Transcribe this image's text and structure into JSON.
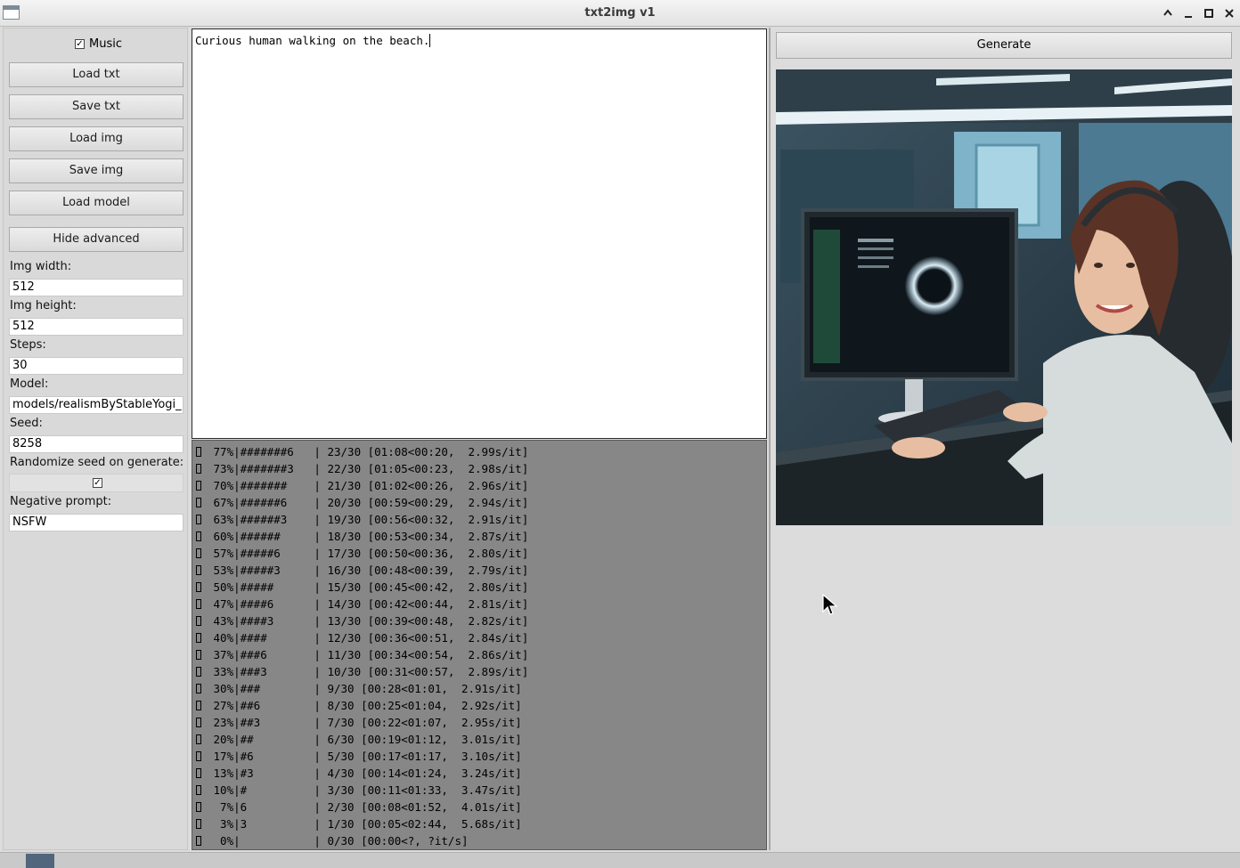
{
  "window": {
    "title": "txt2img v1"
  },
  "sidebar": {
    "music_label": "Music",
    "music_checked": true,
    "buttons": {
      "load_txt": "Load txt",
      "save_txt": "Save txt",
      "load_img": "Load img",
      "save_img": "Save img",
      "load_model": "Load model",
      "hide_advanced": "Hide advanced"
    },
    "fields": {
      "img_width_label": "Img width:",
      "img_width_value": "512",
      "img_height_label": "Img height:",
      "img_height_value": "512",
      "steps_label": "Steps:",
      "steps_value": "30",
      "model_label": "Model:",
      "model_value": "models/realismByStableYogi_",
      "seed_label": "Seed:",
      "seed_value": "8258",
      "randomize_label": "Randomize seed on generate:",
      "randomize_checked": true,
      "negative_label": "Negative prompt:",
      "negative_value": "NSFW"
    }
  },
  "prompt": {
    "text": "Curious human walking on the beach."
  },
  "console": {
    "lines": [
      " 77%|#######6   | 23/30 [01:08<00:20,  2.99s/it]",
      " 73%|#######3   | 22/30 [01:05<00:23,  2.98s/it]",
      " 70%|#######    | 21/30 [01:02<00:26,  2.96s/it]",
      " 67%|######6    | 20/30 [00:59<00:29,  2.94s/it]",
      " 63%|######3    | 19/30 [00:56<00:32,  2.91s/it]",
      " 60%|######     | 18/30 [00:53<00:34,  2.87s/it]",
      " 57%|#####6     | 17/30 [00:50<00:36,  2.80s/it]",
      " 53%|#####3     | 16/30 [00:48<00:39,  2.79s/it]",
      " 50%|#####      | 15/30 [00:45<00:42,  2.80s/it]",
      " 47%|####6      | 14/30 [00:42<00:44,  2.81s/it]",
      " 43%|####3      | 13/30 [00:39<00:48,  2.82s/it]",
      " 40%|####       | 12/30 [00:36<00:51,  2.84s/it]",
      " 37%|###6       | 11/30 [00:34<00:54,  2.86s/it]",
      " 33%|###3       | 10/30 [00:31<00:57,  2.89s/it]",
      " 30%|###        | 9/30 [00:28<01:01,  2.91s/it]",
      " 27%|##6        | 8/30 [00:25<01:04,  2.92s/it]",
      " 23%|##3        | 7/30 [00:22<01:07,  2.95s/it]",
      " 20%|##         | 6/30 [00:19<01:12,  3.01s/it]",
      " 17%|#6         | 5/30 [00:17<01:17,  3.10s/it]",
      " 13%|#3         | 4/30 [00:14<01:24,  3.24s/it]",
      " 10%|#          | 3/30 [00:11<01:33,  3.47s/it]",
      "  7%|6          | 2/30 [00:08<01:52,  4.01s/it]",
      "  3%|3          | 1/30 [00:05<02:44,  5.68s/it]",
      "  0%|           | 0/30 [00:00<?, ?it/s]"
    ]
  },
  "generate": {
    "label": "Generate"
  },
  "icons": {
    "title_controls": [
      "chevron-up-icon",
      "minimize-icon",
      "maximize-icon",
      "close-icon"
    ],
    "image": "generated-image"
  },
  "colors": {
    "background": "#dcdcdc",
    "console_bg": "#878787",
    "taskbar_item": "#51657c"
  }
}
